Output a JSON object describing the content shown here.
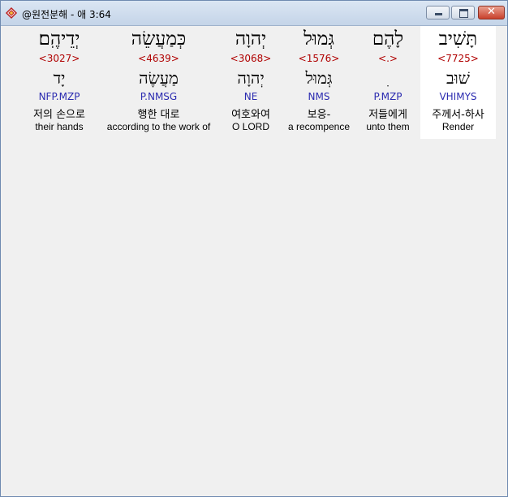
{
  "window": {
    "title": "@원전분해 - 애 3:64",
    "icon": "app-logo-icon",
    "controls": {
      "minimize": "minimize-icon",
      "maximize": "maximize-icon",
      "close": "✕"
    }
  },
  "words": [
    {
      "hebrew": "יְדֵיהֶֽם׃",
      "strong": "<3027>",
      "lemma": "יָד",
      "parse": "NFP.MZP",
      "korean": "저의 손으로",
      "english": "their hands",
      "selected": false
    },
    {
      "hebrew": "כְּמַעֲשֵׂה",
      "strong": "<4639>",
      "lemma": "מַעֲשֶׂה",
      "parse": "P.NMSG",
      "korean": "행한 대로",
      "english": "according to the work of",
      "selected": false
    },
    {
      "hebrew": "יְהוָה",
      "strong": "<3068>",
      "lemma": "יְהוָה",
      "parse": "NE",
      "korean": "여호와여",
      "english": "O LORD",
      "selected": false
    },
    {
      "hebrew": "גְּמוּל",
      "strong": "<1576>",
      "lemma": "גְּמוּל",
      "parse": "NMS",
      "korean": "보응-",
      "english": "a recompence",
      "selected": false
    },
    {
      "hebrew": "לָהֶם",
      "strong": "<.>",
      "lemma": "ִ",
      "parse": "P.MZP",
      "korean": "저들에게",
      "english": "unto them",
      "selected": false
    },
    {
      "hebrew": "תָּשִׁיב",
      "strong": "<7725>",
      "lemma": "שׁוּב",
      "parse": "VHIMYS",
      "korean": "주께서-하사",
      "english": "Render",
      "selected": true
    }
  ]
}
